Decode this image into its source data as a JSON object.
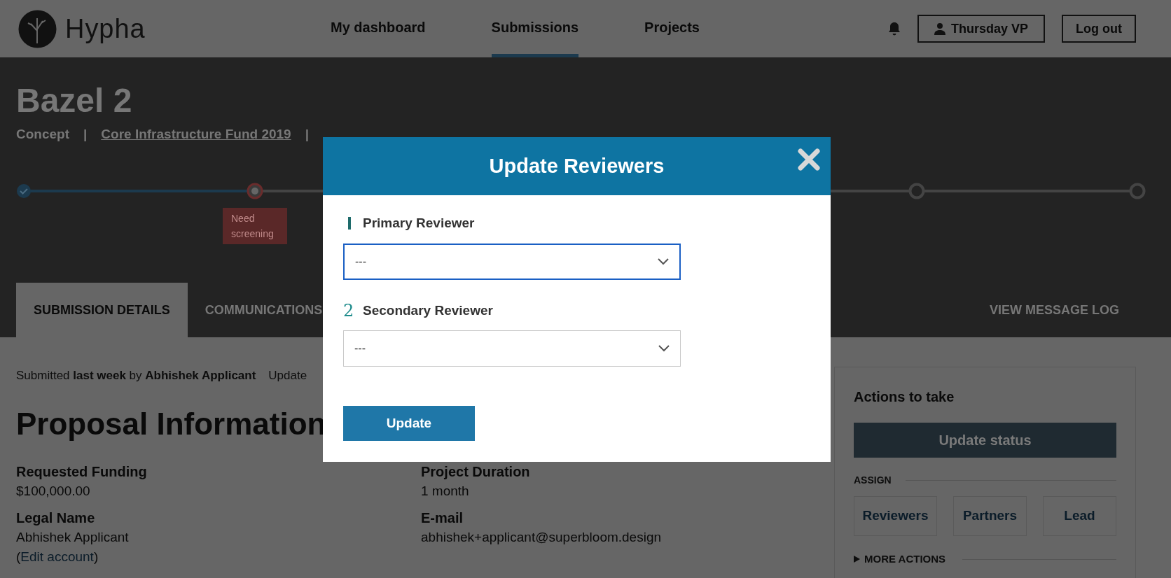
{
  "header": {
    "logo": "Hypha",
    "nav": [
      {
        "label": "My dashboard",
        "selected": false
      },
      {
        "label": "Submissions",
        "selected": true
      },
      {
        "label": "Projects",
        "selected": false
      }
    ],
    "user_button": "Thursday VP",
    "logout_button": "Log out"
  },
  "submission": {
    "title": "Bazel 2",
    "separator": "|",
    "meta": [
      {
        "kind": "text",
        "text": "Concept"
      },
      {
        "kind": "link",
        "text": "Core Infrastructure Fund 2019"
      }
    ]
  },
  "progress": {
    "steps": [
      {
        "kind": "done"
      },
      {
        "kind": "current",
        "label": "Need screening"
      },
      {
        "kind": "todo"
      },
      {
        "kind": "todo"
      }
    ]
  },
  "tabs": [
    {
      "label": "SUBMISSION DETAILS",
      "selected": true
    },
    {
      "label": "COMMUNICATIONS",
      "selected": false
    }
  ],
  "message_log": "VIEW MESSAGE LOG",
  "submitted_line": "Submitted **last week** by **Abhishek Applicant**",
  "updated_fragment": "Update",
  "section_title": "Proposal Information",
  "fields": [
    {
      "label": "Requested Funding",
      "value": "$100,000.00"
    },
    {
      "label": "Project Duration",
      "value": "1 month"
    },
    {
      "label": "Legal Name",
      "value": "Abhishek Applicant"
    },
    {
      "label": "E-mail",
      "value": "abhishek+applicant@superbloom.design"
    }
  ],
  "edit_link": {
    "open": "(",
    "text": "Edit account",
    "close": ")"
  },
  "actions": {
    "title": "Actions to take",
    "primary": "Update status",
    "assign_label": "ASSIGN",
    "assign_buttons": [
      "Reviewers",
      "Partners",
      "Lead"
    ],
    "more": "MORE ACTIONS",
    "more_expanded": false
  },
  "modal": {
    "title": "Update Reviewers",
    "submit": "Update",
    "fields": [
      {
        "kind": "bar",
        "label": "Primary Reviewer",
        "value": "---",
        "focused": true
      },
      {
        "kind": "number",
        "marker": "2",
        "label": "Secondary Reviewer",
        "value": "---",
        "focused": false
      }
    ]
  }
}
